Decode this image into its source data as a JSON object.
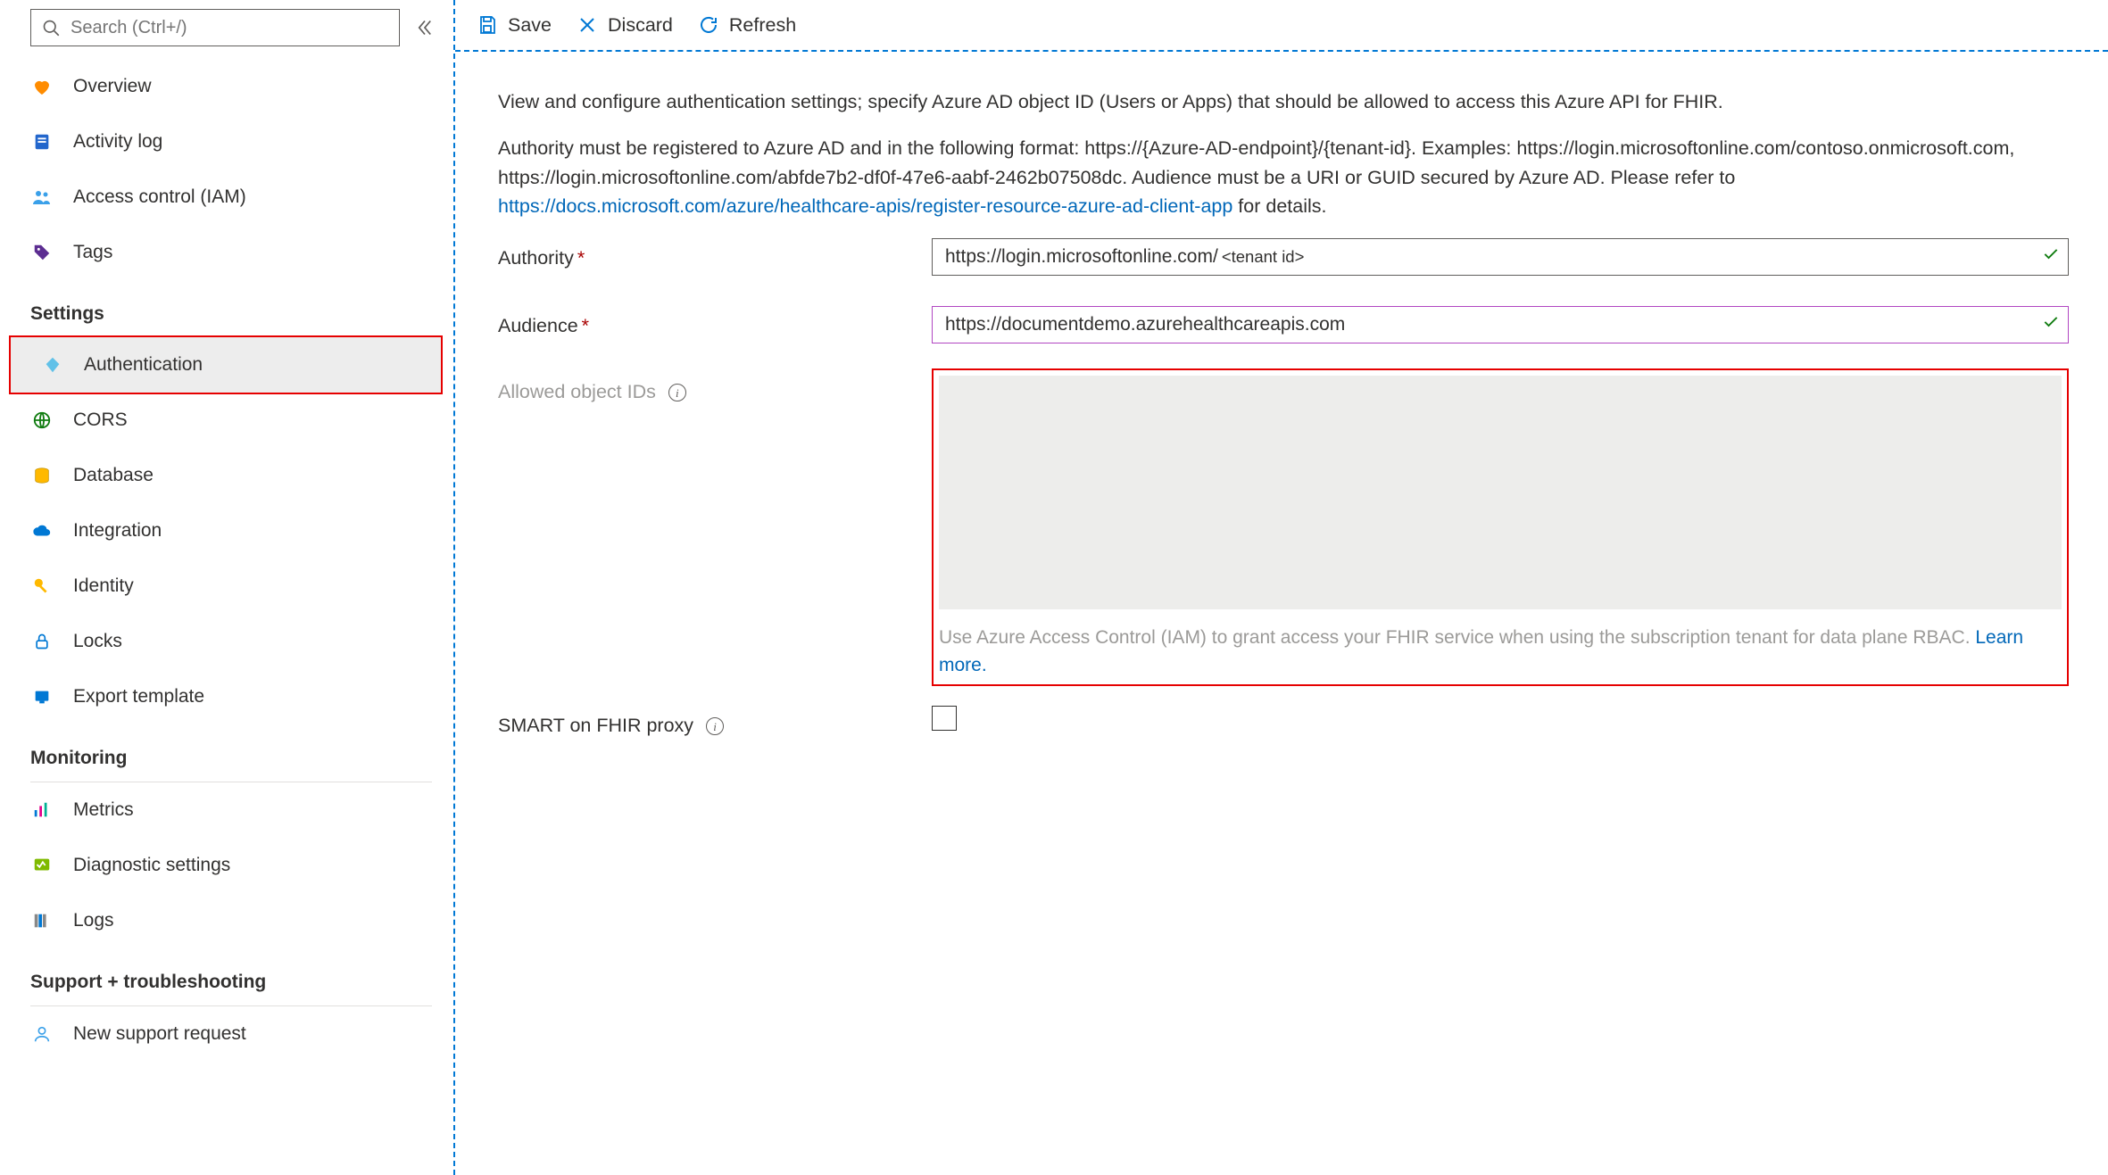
{
  "sidebar": {
    "search_placeholder": "Search (Ctrl+/)",
    "top_items": [
      {
        "label": "Overview",
        "icon": "heart"
      },
      {
        "label": "Activity log",
        "icon": "log"
      },
      {
        "label": "Access control (IAM)",
        "icon": "people"
      },
      {
        "label": "Tags",
        "icon": "tag"
      }
    ],
    "settings_header": "Settings",
    "settings_items": [
      {
        "label": "Authentication",
        "icon": "diamond",
        "active": true
      },
      {
        "label": "CORS",
        "icon": "globe"
      },
      {
        "label": "Database",
        "icon": "db"
      },
      {
        "label": "Integration",
        "icon": "cloud"
      },
      {
        "label": "Identity",
        "icon": "key"
      },
      {
        "label": "Locks",
        "icon": "lock"
      },
      {
        "label": "Export template",
        "icon": "export"
      }
    ],
    "monitoring_header": "Monitoring",
    "monitoring_items": [
      {
        "label": "Metrics",
        "icon": "metrics"
      },
      {
        "label": "Diagnostic settings",
        "icon": "diag"
      },
      {
        "label": "Logs",
        "icon": "logs"
      }
    ],
    "support_header": "Support + troubleshooting",
    "support_items": [
      {
        "label": "New support request",
        "icon": "support"
      }
    ]
  },
  "toolbar": {
    "save_label": "Save",
    "discard_label": "Discard",
    "refresh_label": "Refresh"
  },
  "content": {
    "intro": "View and configure authentication settings; specify Azure AD object ID (Users or Apps) that should be allowed to access this Azure API for FHIR.",
    "details_pre": "Authority must be registered to Azure AD and in the following format: https://{Azure-AD-endpoint}/{tenant-id}. Examples: https://login.microsoftonline.com/contoso.onmicrosoft.com, https://login.microsoftonline.com/abfde7b2-df0f-47e6-aabf-2462b07508dc. Audience must be a URI or GUID secured by Azure AD. Please refer to ",
    "details_link_text": "https://docs.microsoft.com/azure/healthcare-apis/register-resource-azure-ad-client-app",
    "details_post": " for details.",
    "authority_label": "Authority",
    "authority_value": "https://login.microsoftonline.com/ ",
    "authority_tag": "<tenant id>",
    "audience_label": "Audience",
    "audience_value": "https://documentdemo.azurehealthcareapis.com",
    "objectids_label": "Allowed object IDs",
    "objectids_hint_pre": "Use Azure Access Control (IAM) to grant access your FHIR service when using the subscription tenant for data plane RBAC. ",
    "objectids_hint_link": "Learn more.",
    "smart_label": "SMART on FHIR proxy"
  }
}
